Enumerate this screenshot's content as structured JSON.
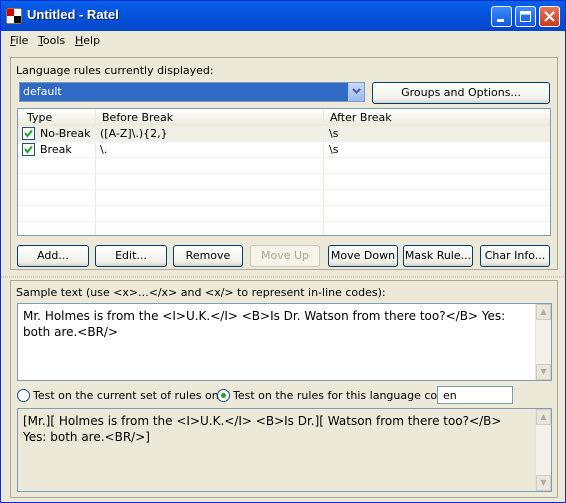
{
  "window": {
    "title": "Untitled - Ratel"
  },
  "menu": {
    "items": [
      "File",
      "Tools",
      "Help"
    ],
    "mnemonics": [
      "F",
      "T",
      "H"
    ]
  },
  "rules_panel": {
    "label": "Language rules currently displayed:",
    "combo_value": "default",
    "groups_button": "Groups and Options...",
    "columns": [
      "Type",
      "Before Break",
      "After Break"
    ],
    "rows": [
      {
        "type": "No-Break",
        "before": "([A-Z]\\.){2,}",
        "after": "\\s",
        "checked": true
      },
      {
        "type": "Break",
        "before": "\\.",
        "after": "\\s",
        "checked": true
      }
    ],
    "buttons": {
      "add": "Add...",
      "edit": "Edit...",
      "remove": "Remove",
      "move_up": "Move Up",
      "move_down": "Move Down",
      "mask_rule": "Mask Rule...",
      "char_info": "Char Info..."
    }
  },
  "test_panel": {
    "sample_label": "Sample text (use <x>...</x> and <x/> to represent in-line codes):",
    "sample_text": "Mr. Holmes is from the <I>U.K.</I> <B>Is Dr. Watson from there too?</B> Yes: both are.<BR/>",
    "radio_current": "Test on the current set of rules only",
    "radio_language": "Test on the rules for this language code:",
    "language_code": "en",
    "result_text": "[Mr.][ Holmes is from the <I>U.K.</I> <B>Is Dr.][ Watson from there too?</B> Yes: both are.<BR/>]"
  },
  "colors": {
    "title_bar": "#0555e0",
    "selection": "#316ac5",
    "close_button": "#c83b1a"
  }
}
